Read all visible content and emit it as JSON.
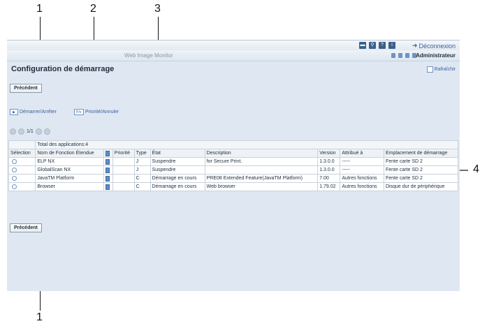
{
  "callouts": {
    "top": [
      "1",
      "2",
      "3"
    ],
    "right": "4",
    "bottom": "1"
  },
  "topbar": {
    "logout_label": "Déconnexion",
    "icons": [
      "keyboard-icon",
      "search-icon",
      "help-icon",
      "info-icon"
    ]
  },
  "header": {
    "app_title": "Web Image Monitor",
    "user_label": "Administrateur"
  },
  "page": {
    "title": "Configuration de démarrage",
    "refresh_label": "Rafraîchir"
  },
  "buttons": {
    "previous_top": "Précédent",
    "previous_bottom": "Précédent"
  },
  "toolbar": {
    "start_stop_label": "Démarrer/Arrêter",
    "priority_cancel_label": "Priorité/Annuler"
  },
  "pager": {
    "page_text": "1/1"
  },
  "table": {
    "total_label": "Total des applications:4",
    "columns": [
      "Sélection",
      "Nom de Fonction Étendue",
      "",
      "Priorité",
      "Type",
      "État",
      "Description",
      "Version",
      "Attribué à",
      "Emplacement de démarrage"
    ],
    "rows": [
      {
        "name": "ELP NX",
        "priority": "",
        "type": "J",
        "state": "Suspendre",
        "description": "for Secure Print.",
        "version": "1.3.0.0",
        "assigned": "-----",
        "location": "Fente carte SD 2"
      },
      {
        "name": "GlobalScan NX",
        "priority": "",
        "type": "J",
        "state": "Suspendre",
        "description": "",
        "version": "1.3.0.0",
        "assigned": "-----",
        "location": "Fente carte SD 2"
      },
      {
        "name": "JavaTM Platform",
        "priority": "",
        "type": "C",
        "state": "Démarrage en cours",
        "description": "PRE08 Extended Feature(JavaTM Platform)",
        "version": "7.00",
        "assigned": "Autres fonctions",
        "location": "Fente carte SD 2"
      },
      {
        "name": "Browser",
        "priority": "",
        "type": "C",
        "state": "Démarrage en cours",
        "description": "Web browser",
        "version": "1.79.02",
        "assigned": "Autres fonctions",
        "location": "Disque dur de périphérique"
      }
    ]
  }
}
